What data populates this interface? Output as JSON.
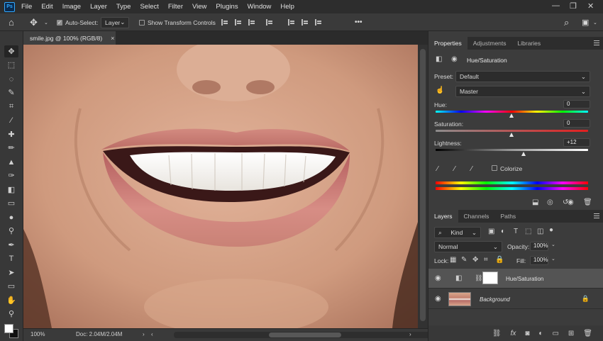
{
  "app": {
    "logo_text": "Ps",
    "menu": [
      "File",
      "Edit",
      "Image",
      "Layer",
      "Type",
      "Select",
      "Filter",
      "View",
      "Plugins",
      "Window",
      "Help"
    ]
  },
  "options_bar": {
    "auto_select_label": "Auto-Select:",
    "auto_select_checked": true,
    "layer_dropdown": "Layer",
    "show_transform_label": "Show Transform Controls",
    "more_label": "•••"
  },
  "document": {
    "tab_title": "smile.jpg @ 100% (RGB/8)",
    "tab_close": "×",
    "zoom": "100%",
    "doc_info": "Doc: 2.04M/2.04M"
  },
  "properties_panel": {
    "tabs": [
      "Properties",
      "Adjustments",
      "Libraries"
    ],
    "active_tab": "Properties",
    "adjustment_title": "Hue/Saturation",
    "preset_label": "Preset:",
    "preset_value": "Default",
    "channel_value": "Master",
    "hue_label": "Hue:",
    "hue_value": "0",
    "saturation_label": "Saturation:",
    "saturation_value": "0",
    "lightness_label": "Lightness:",
    "lightness_value": "+12",
    "colorize_label": "Colorize",
    "colorize_checked": false
  },
  "layers_panel": {
    "tabs": [
      "Layers",
      "Channels",
      "Paths"
    ],
    "active_tab": "Layers",
    "filter_kind": "Kind",
    "blend_mode": "Normal",
    "opacity_label": "Opacity:",
    "opacity_value": "100%",
    "lock_label": "Lock:",
    "fill_label": "Fill:",
    "fill_value": "100%",
    "layers": [
      {
        "name": "Hue/Saturation",
        "selected": true
      },
      {
        "name": "Background",
        "selected": false
      }
    ]
  },
  "colors": {
    "accent": "#31a8ff",
    "panel_bg": "#3c3c3c",
    "menubar_bg": "#2d2d2d",
    "selected_layer": "#545454"
  }
}
